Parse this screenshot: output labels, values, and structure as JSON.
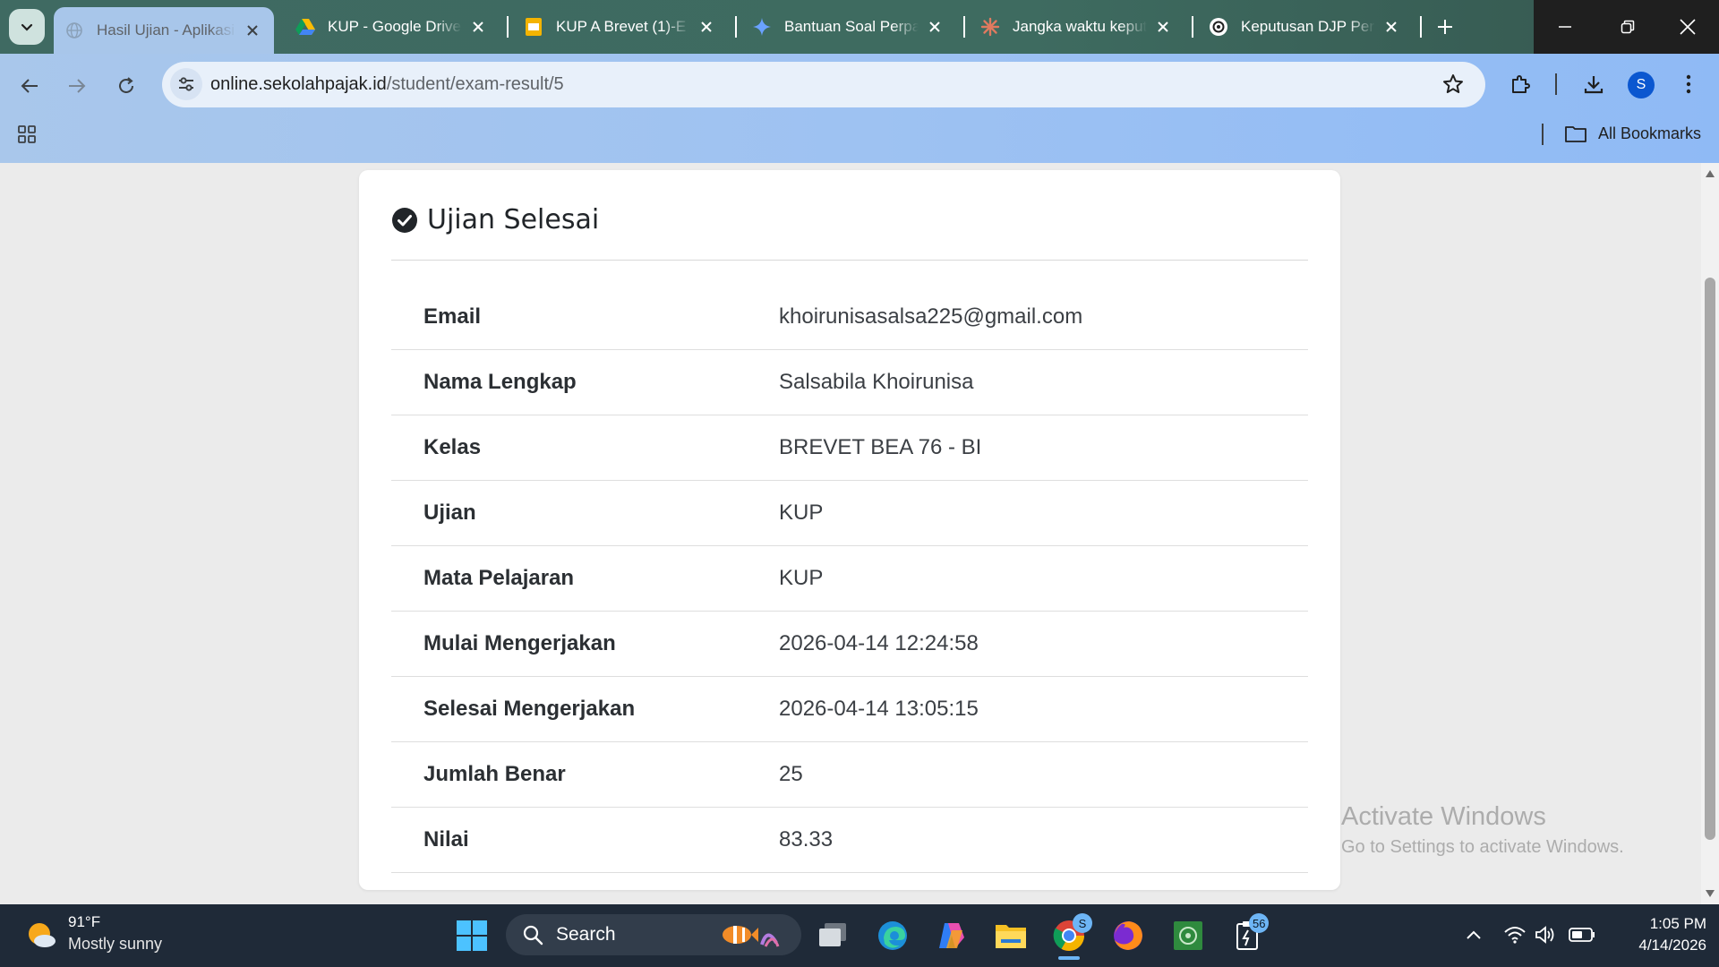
{
  "browser": {
    "tabs": [
      {
        "title": "Hasil Ujian - Aplikasi Sekolah Pajak",
        "active": true,
        "icon": "globe-icon"
      },
      {
        "title": "KUP - Google Drive",
        "active": false,
        "icon": "google-drive-icon"
      },
      {
        "title": "KUP A Brevet (1)-E",
        "active": false,
        "icon": "slides-icon"
      },
      {
        "title": "Bantuan Soal Perpajakan",
        "active": false,
        "icon": "gemini-icon"
      },
      {
        "title": "Jangka waktu keputusan",
        "active": false,
        "icon": "claude-icon"
      },
      {
        "title": "Keputusan DJP Perpajakan",
        "active": false,
        "icon": "chatgpt-icon"
      }
    ],
    "url_domain": "online.sekolahpajak.id",
    "url_path": "/student/exam-result/5",
    "profile_initial": "S",
    "bookmarks_label": "All Bookmarks"
  },
  "card": {
    "title": "Ujian Selesai",
    "rows": [
      {
        "label": "Email",
        "value": "khoirunisasalsa225@gmail.com"
      },
      {
        "label": "Nama Lengkap",
        "value": "Salsabila Khoirunisa"
      },
      {
        "label": "Kelas",
        "value": "BREVET BEA 76 - BI"
      },
      {
        "label": "Ujian",
        "value": "KUP"
      },
      {
        "label": "Mata Pelajaran",
        "value": "KUP"
      },
      {
        "label": "Mulai Mengerjakan",
        "value": "2026-04-14 12:24:58"
      },
      {
        "label": "Selesai Mengerjakan",
        "value": "2026-04-14 13:05:15"
      },
      {
        "label": "Jumlah Benar",
        "value": "25"
      },
      {
        "label": "Nilai",
        "value": "83.33"
      }
    ]
  },
  "watermark": {
    "line1": "Activate Windows",
    "line2": "Go to Settings to activate Windows."
  },
  "taskbar": {
    "weather_temp": "91°F",
    "weather_condition": "Mostly sunny",
    "search_label": "Search",
    "chrome_badge": "S",
    "notification_count": "56",
    "time": "1:05 PM",
    "date": "4/14/2026"
  },
  "colors": {
    "tabstrip": "#3f6a62",
    "toolbar": "#a9c7eb",
    "accent_blue": "#0b57d0",
    "taskbar": "#1f2a38"
  }
}
